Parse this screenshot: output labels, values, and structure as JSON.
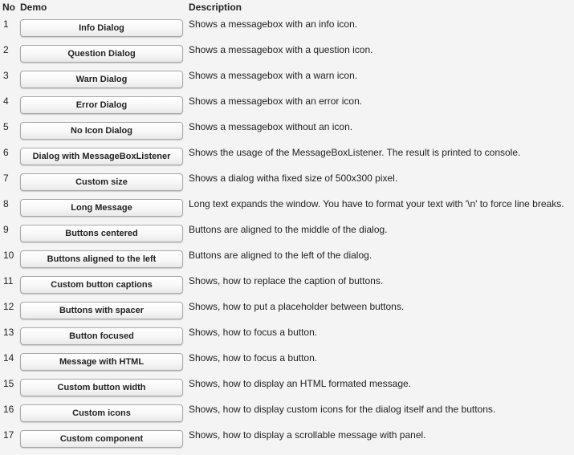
{
  "headers": {
    "no": "No",
    "demo": "Demo",
    "description": "Description"
  },
  "rows": [
    {
      "no": "1",
      "label": "Info Dialog",
      "description": "Shows a messagebox with an info icon."
    },
    {
      "no": "2",
      "label": "Question Dialog",
      "description": "Shows a messagebox with a question icon."
    },
    {
      "no": "3",
      "label": "Warn Dialog",
      "description": "Shows a messagebox with a warn icon."
    },
    {
      "no": "4",
      "label": "Error Dialog",
      "description": "Shows a messagebox with an error icon."
    },
    {
      "no": "5",
      "label": "No Icon Dialog",
      "description": "Shows a messagebox without an icon."
    },
    {
      "no": "6",
      "label": "Dialog with MessageBoxListener",
      "description": "Shows the usage of the MessageBoxListener. The result is printed to console."
    },
    {
      "no": "7",
      "label": "Custom size",
      "description": "Shows a dialog witha fixed size of 500x300 pixel."
    },
    {
      "no": "8",
      "label": "Long Message",
      "description": "Long text expands the window. You have to format your text with '\\n' to force line breaks."
    },
    {
      "no": "9",
      "label": "Buttons centered",
      "description": "Buttons are aligned to the middle of the dialog."
    },
    {
      "no": "10",
      "label": "Buttons aligned to the left",
      "description": "Buttons are aligned to the left of the dialog."
    },
    {
      "no": "11",
      "label": "Custom button captions",
      "description": "Shows, how to replace the caption of buttons."
    },
    {
      "no": "12",
      "label": "Buttons with spacer",
      "description": "Shows, how to put a placeholder between buttons."
    },
    {
      "no": "13",
      "label": "Button focused",
      "description": "Shows, how to focus a button."
    },
    {
      "no": "14",
      "label": "Message with HTML",
      "description": "Shows, how to focus a button."
    },
    {
      "no": "15",
      "label": "Custom button width",
      "description": "Shows, how to display an HTML formated message."
    },
    {
      "no": "16",
      "label": "Custom icons",
      "description": "Shows, how to display custom icons for the dialog itself and the buttons."
    },
    {
      "no": "17",
      "label": "Custom component",
      "description": "Shows, how to display a scrollable message with panel."
    }
  ]
}
